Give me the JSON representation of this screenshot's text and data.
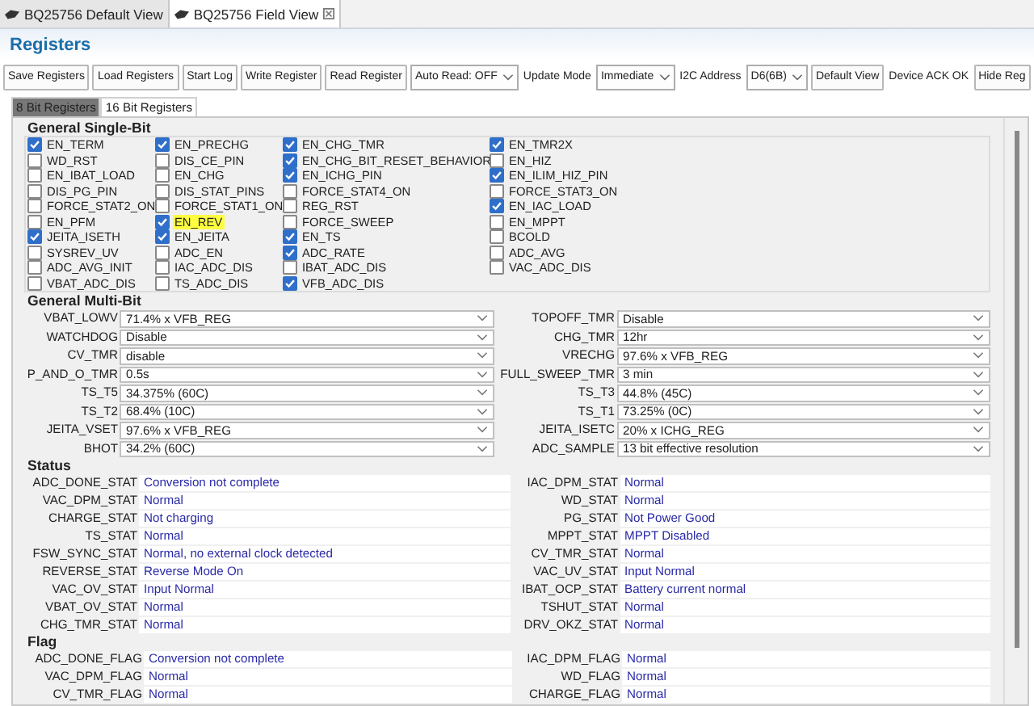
{
  "editor_tabs": [
    {
      "label": "BQ25756 Default View",
      "selected": false
    },
    {
      "label": "BQ25756 Field View",
      "selected": true
    }
  ],
  "panel_title": "Registers",
  "toolbar": [
    {
      "kind": "button",
      "text": "Save Registers"
    },
    {
      "kind": "button",
      "text": "Load Registers"
    },
    {
      "kind": "button",
      "text": "Start Log"
    },
    {
      "kind": "button",
      "text": "Write Register"
    },
    {
      "kind": "button",
      "text": "Read Register"
    },
    {
      "kind": "select",
      "text": "Auto Read: OFF"
    },
    {
      "kind": "label",
      "text": "Update Mode"
    },
    {
      "kind": "select",
      "text": "Immediate"
    },
    {
      "kind": "label",
      "text": "I2C Address"
    },
    {
      "kind": "select",
      "text": "D6(6B)"
    },
    {
      "kind": "button",
      "text": "Default View"
    },
    {
      "kind": "label",
      "text": "Device ACK OK"
    },
    {
      "kind": "button",
      "text": "Hide Reg"
    }
  ],
  "register_tabs": [
    {
      "label": "8 Bit Registers",
      "selected": true
    },
    {
      "label": "16 Bit Registers",
      "selected": false
    }
  ],
  "single_bit": {
    "title": "General Single-Bit",
    "items": [
      {
        "label": "EN_TERM",
        "checked": true,
        "highlighted": false
      },
      {
        "label": "EN_PRECHG",
        "checked": true,
        "highlighted": false
      },
      {
        "label": "EN_CHG_TMR",
        "checked": true,
        "highlighted": false
      },
      {
        "label": "EN_TMR2X",
        "checked": true,
        "highlighted": false
      },
      {
        "label": "WD_RST",
        "checked": false,
        "highlighted": false
      },
      {
        "label": "DIS_CE_PIN",
        "checked": false,
        "highlighted": false
      },
      {
        "label": "EN_CHG_BIT_RESET_BEHAVIOR",
        "checked": true,
        "highlighted": false
      },
      {
        "label": "EN_HIZ",
        "checked": false,
        "highlighted": false
      },
      {
        "label": "EN_IBAT_LOAD",
        "checked": false,
        "highlighted": false
      },
      {
        "label": "EN_CHG",
        "checked": false,
        "highlighted": false
      },
      {
        "label": "EN_ICHG_PIN",
        "checked": true,
        "highlighted": false
      },
      {
        "label": "EN_ILIM_HIZ_PIN",
        "checked": true,
        "highlighted": false
      },
      {
        "label": "DIS_PG_PIN",
        "checked": false,
        "highlighted": false
      },
      {
        "label": "DIS_STAT_PINS",
        "checked": false,
        "highlighted": false
      },
      {
        "label": "FORCE_STAT4_ON",
        "checked": false,
        "highlighted": false
      },
      {
        "label": "FORCE_STAT3_ON",
        "checked": false,
        "highlighted": false
      },
      {
        "label": "FORCE_STAT2_ON",
        "checked": false,
        "highlighted": false
      },
      {
        "label": "FORCE_STAT1_ON",
        "checked": false,
        "highlighted": false
      },
      {
        "label": "REG_RST",
        "checked": false,
        "highlighted": false
      },
      {
        "label": "EN_IAC_LOAD",
        "checked": true,
        "highlighted": false
      },
      {
        "label": "EN_PFM",
        "checked": false,
        "highlighted": false
      },
      {
        "label": "EN_REV",
        "checked": true,
        "highlighted": true
      },
      {
        "label": "FORCE_SWEEP",
        "checked": false,
        "highlighted": false
      },
      {
        "label": "EN_MPPT",
        "checked": false,
        "highlighted": false
      },
      {
        "label": "JEITA_ISETH",
        "checked": true,
        "highlighted": false
      },
      {
        "label": "EN_JEITA",
        "checked": true,
        "highlighted": false
      },
      {
        "label": "EN_TS",
        "checked": true,
        "highlighted": false
      },
      {
        "label": "BCOLD",
        "checked": false,
        "highlighted": false
      },
      {
        "label": "SYSREV_UV",
        "checked": false,
        "highlighted": false
      },
      {
        "label": "ADC_EN",
        "checked": false,
        "highlighted": false
      },
      {
        "label": "ADC_RATE",
        "checked": true,
        "highlighted": false
      },
      {
        "label": "ADC_AVG",
        "checked": false,
        "highlighted": false
      },
      {
        "label": "ADC_AVG_INIT",
        "checked": false,
        "highlighted": false
      },
      {
        "label": "IAC_ADC_DIS",
        "checked": false,
        "highlighted": false
      },
      {
        "label": "IBAT_ADC_DIS",
        "checked": false,
        "highlighted": false
      },
      {
        "label": "VAC_ADC_DIS",
        "checked": false,
        "highlighted": false
      },
      {
        "label": "VBAT_ADC_DIS",
        "checked": false,
        "highlighted": false
      },
      {
        "label": "TS_ADC_DIS",
        "checked": false,
        "highlighted": false
      },
      {
        "label": "VFB_ADC_DIS",
        "checked": true,
        "highlighted": false
      }
    ]
  },
  "multi_bit": {
    "title": "General Multi-Bit",
    "fields": [
      {
        "label": "VBAT_LOWV",
        "value": "71.4% x VFB_REG"
      },
      {
        "label": "TOPOFF_TMR",
        "value": "Disable"
      },
      {
        "label": "WATCHDOG",
        "value": "Disable"
      },
      {
        "label": "CHG_TMR",
        "value": "12hr"
      },
      {
        "label": "CV_TMR",
        "value": "disable"
      },
      {
        "label": "VRECHG",
        "value": "97.6% x VFB_REG"
      },
      {
        "label": "P_AND_O_TMR",
        "value": "0.5s"
      },
      {
        "label": "FULL_SWEEP_TMR",
        "value": "3 min"
      },
      {
        "label": "TS_T5",
        "value": "34.375% (60C)"
      },
      {
        "label": "TS_T3",
        "value": "44.8% (45C)"
      },
      {
        "label": "TS_T2",
        "value": "68.4% (10C)"
      },
      {
        "label": "TS_T1",
        "value": "73.25% (0C)"
      },
      {
        "label": "JEITA_VSET",
        "value": "97.6% x VFB_REG"
      },
      {
        "label": "JEITA_ISETC",
        "value": "20% x ICHG_REG"
      },
      {
        "label": "BHOT",
        "value": "34.2% (60C)"
      },
      {
        "label": "ADC_SAMPLE",
        "value": "13 bit effective resolution"
      }
    ]
  },
  "status": {
    "title": "Status",
    "fields": [
      {
        "label": "ADC_DONE_STAT",
        "value": "Conversion not complete"
      },
      {
        "label": "IAC_DPM_STAT",
        "value": "Normal"
      },
      {
        "label": "VAC_DPM_STAT",
        "value": "Normal"
      },
      {
        "label": "WD_STAT",
        "value": "Normal"
      },
      {
        "label": "CHARGE_STAT",
        "value": "Not charging"
      },
      {
        "label": "PG_STAT",
        "value": "Not Power Good"
      },
      {
        "label": "TS_STAT",
        "value": "Normal"
      },
      {
        "label": "MPPT_STAT",
        "value": "MPPT Disabled"
      },
      {
        "label": "FSW_SYNC_STAT",
        "value": "Normal, no external clock detected"
      },
      {
        "label": "CV_TMR_STAT",
        "value": "Normal"
      },
      {
        "label": "REVERSE_STAT",
        "value": "Reverse Mode On"
      },
      {
        "label": "VAC_UV_STAT",
        "value": "Input Normal"
      },
      {
        "label": "VAC_OV_STAT",
        "value": "Input Normal"
      },
      {
        "label": "IBAT_OCP_STAT",
        "value": "Battery current normal"
      },
      {
        "label": "VBAT_OV_STAT",
        "value": "Normal"
      },
      {
        "label": "TSHUT_STAT",
        "value": "Normal"
      },
      {
        "label": "CHG_TMR_STAT",
        "value": "Normal"
      },
      {
        "label": "DRV_OKZ_STAT",
        "value": "Normal"
      }
    ]
  },
  "flag": {
    "title": "Flag",
    "fields": [
      {
        "label": "ADC_DONE_FLAG",
        "value": "Conversion not complete"
      },
      {
        "label": "IAC_DPM_FLAG",
        "value": "Normal"
      },
      {
        "label": "VAC_DPM_FLAG",
        "value": "Normal"
      },
      {
        "label": "WD_FLAG",
        "value": "Normal"
      },
      {
        "label": "CV_TMR_FLAG",
        "value": "Normal"
      },
      {
        "label": "CHARGE_FLAG",
        "value": "Normal"
      }
    ]
  }
}
